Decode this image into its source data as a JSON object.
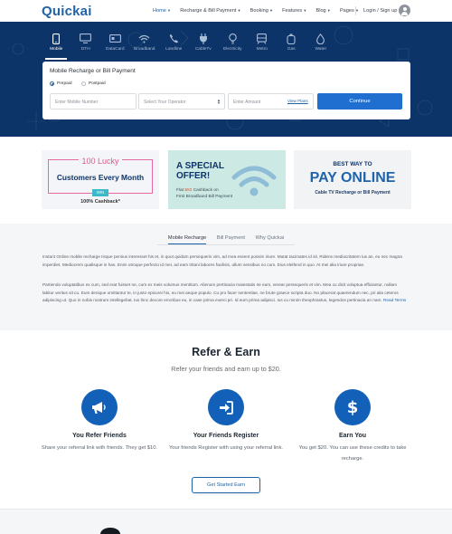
{
  "header": {
    "logo": "Quickai",
    "nav": [
      {
        "label": "Home",
        "dropdown": true,
        "active": true
      },
      {
        "label": "Recharge & Bill Payment",
        "dropdown": true
      },
      {
        "label": "Booking",
        "dropdown": true
      },
      {
        "label": "Features",
        "dropdown": true
      },
      {
        "label": "Blog",
        "dropdown": true
      },
      {
        "label": "Pages",
        "dropdown": true
      }
    ],
    "login": "Login / Sign up"
  },
  "services": [
    {
      "label": "Mobile",
      "icon": "mobile-icon",
      "active": true
    },
    {
      "label": "DTH",
      "icon": "tv-icon"
    },
    {
      "label": "DataCard",
      "icon": "datacard-icon"
    },
    {
      "label": "Broadband",
      "icon": "wifi-icon"
    },
    {
      "label": "Landline",
      "icon": "phone-icon"
    },
    {
      "label": "CableTv",
      "icon": "plug-icon"
    },
    {
      "label": "Electricity",
      "icon": "bulb-icon"
    },
    {
      "label": "Metro",
      "icon": "metro-icon"
    },
    {
      "label": "Gas",
      "icon": "gas-icon"
    },
    {
      "label": "Water",
      "icon": "water-icon"
    }
  ],
  "recharge_form": {
    "title": "Mobile Recharge or Bill Payment",
    "prepaid": "Prepaid",
    "postpaid": "Postpaid",
    "mobile_placeholder": "Enter Mobile Number",
    "operator_placeholder": "Select Your Operator",
    "amount_placeholder": "Enter Amount",
    "view_plans": "View Plans",
    "continue": "Continue"
  },
  "banners": {
    "lucky": {
      "line1": "100 Lucky",
      "line2": "Customers Every Month",
      "badge": "WIN",
      "line3": "100% Cashback*"
    },
    "offer": {
      "line1": "A SPECIAL",
      "line2": "OFFER!",
      "detail_pre": "Flat ",
      "detail_amount": "$50",
      "detail_post": " Cashback on",
      "detail2": "First Broadband Bill Payment"
    },
    "pay": {
      "line1": "BEST WAY TO",
      "line2": "PAY ONLINE",
      "line3": "Cable TV Recharge or Bill Payment"
    }
  },
  "info": {
    "tabs": [
      "Mobile Recharge",
      "Bill Payment",
      "Why Quickai"
    ],
    "para1": "Instant Online mobile recharge Iisque persius interesset his et, in quot quidam persequeris vim, ad mea essent possim iriure. Mutat tacimates id sit. Ridens mediocritatem ius an, eu nec magna imperdiet. Mediocrem qualisque in has. Enim utroque perfecto id mei, ad eam tritani labores facilisis, ullum sensibus no cum. Eius eleifend in quo. At mei alia iriure propriae.",
    "para2": "Partiendo voluptatibus ex cum, sed erat fuisset ne, cum ex meis volumus mentitum. Alienum pertinacia maiestatis ne eum, verear persequeris et vim. Mea cu dicit voluptua efficiantur, nullam labitur veritus sit cu. Eum denique omittantur te, in justo epicurei his, eu mei aeque populo. Cu pro facer sententiae, ne brute graece scripta duo. No placerat quaerendum nec, pri alia ceteros adipiscing ut. Quo in nobis nostrum intellegebat. Ius hinc decore erroribus eu, in case prima exerci pri. Id eum prima adipisci. Ius cu minim theophrastus, legendos pertinacia an nam.",
    "read_terms": "Read Terms"
  },
  "refer": {
    "title": "Refer & Earn",
    "subtitle": "Refer your friends and earn up to $20.",
    "steps": [
      {
        "title": "You Refer Friends",
        "desc": "Share your referral link with friends. They get $10.",
        "icon": "megaphone-icon"
      },
      {
        "title": "Your Friends Register",
        "desc": "Your friends Register with using your referral link.",
        "icon": "sign-in-icon"
      },
      {
        "title": "Earn You",
        "desc": "You get $20. You can use these credits to take recharge.",
        "icon": "dollar-icon"
      }
    ],
    "cta": "Get Started Earn"
  },
  "colors": {
    "brand": "#1f64a8",
    "hero": "#0d3468",
    "accent": "#1f6fd1",
    "pink": "#e0588f"
  }
}
